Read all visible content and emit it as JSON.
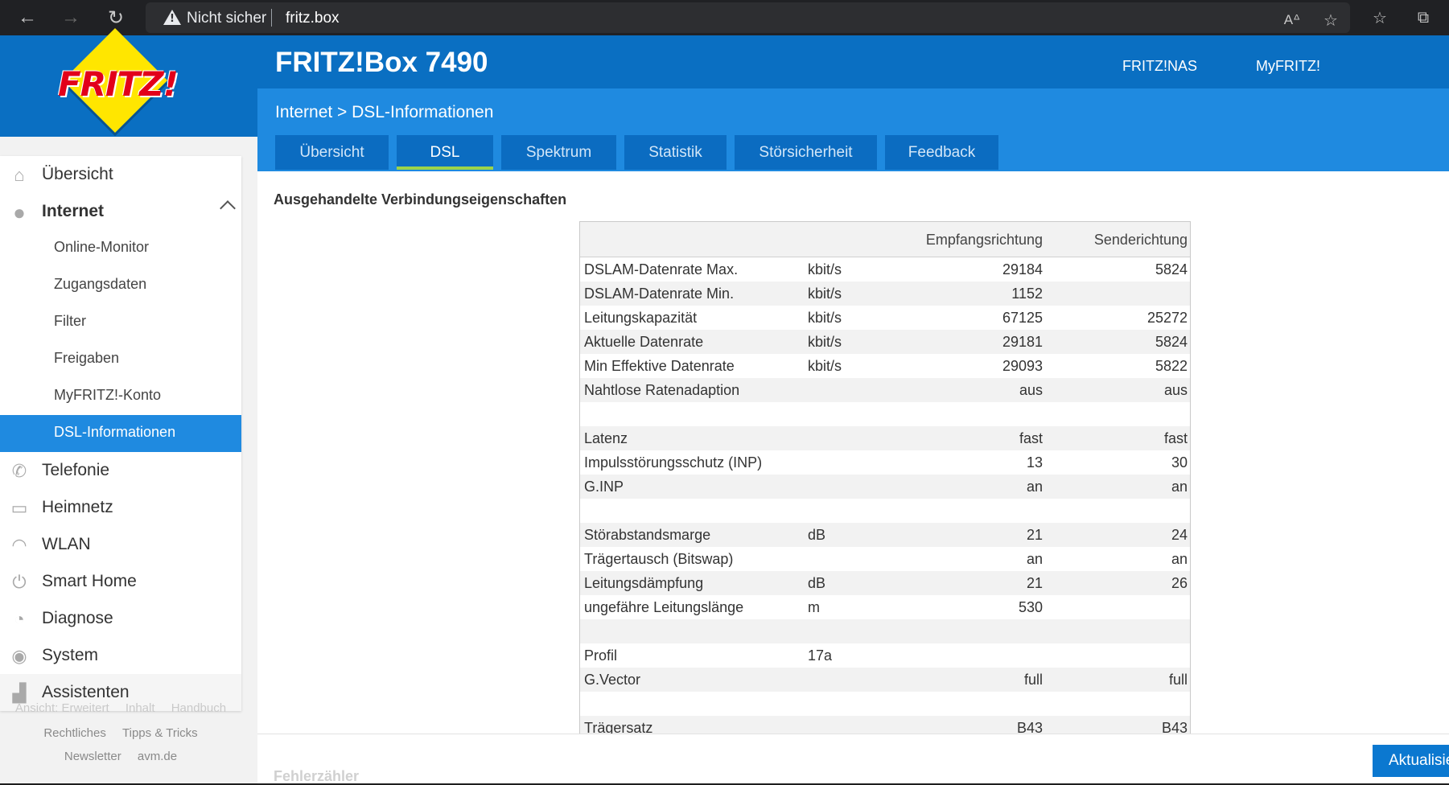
{
  "browser": {
    "security_label": "Nicht sicher",
    "url": "fritz.box"
  },
  "header": {
    "logo_text": "FRITZ!",
    "product_title": "FRITZ!Box 7490",
    "links": [
      "FRITZ!NAS",
      "MyFRITZ!"
    ],
    "accent_color": "#0a6fc2"
  },
  "breadcrumb": "Internet > DSL-Informationen",
  "tabs": [
    {
      "label": "Übersicht"
    },
    {
      "label": "DSL"
    },
    {
      "label": "Spektrum"
    },
    {
      "label": "Statistik"
    },
    {
      "label": "Störsicherheit"
    },
    {
      "label": "Feedback"
    }
  ],
  "active_tab": "DSL",
  "sidebar": {
    "items": [
      {
        "label": "Übersicht",
        "icon": "home-icon"
      },
      {
        "label": "Internet",
        "icon": "globe-icon"
      },
      {
        "label": "Telefonie",
        "icon": "phone-icon"
      },
      {
        "label": "Heimnetz",
        "icon": "network-icon"
      },
      {
        "label": "WLAN",
        "icon": "wifi-icon"
      },
      {
        "label": "Smart Home",
        "icon": "power-icon"
      },
      {
        "label": "Diagnose",
        "icon": "diagnose-icon"
      },
      {
        "label": "System",
        "icon": "system-icon"
      },
      {
        "label": "Assistenten",
        "icon": "wizard-icon"
      }
    ],
    "internet_subitems": [
      "Online-Monitor",
      "Zugangsdaten",
      "Filter",
      "Freigaben",
      "MyFRITZ!-Konto",
      "DSL-Informationen"
    ],
    "footer": {
      "ghost_links": [
        "Ansicht: Erweitert",
        "Inhalt",
        "Handbuch"
      ],
      "row1": [
        "Rechtliches",
        "Tipps & Tricks"
      ],
      "row2": [
        "Newsletter",
        "avm.de"
      ]
    }
  },
  "section_title": "Ausgehandelte Verbindungseigenschaften",
  "table": {
    "headers": [
      "",
      "",
      "Empfangsrichtung",
      "Senderichtung"
    ],
    "rows": [
      [
        "DSLAM-Datenrate Max.",
        "kbit/s",
        "29184",
        "5824"
      ],
      [
        "DSLAM-Datenrate Min.",
        "kbit/s",
        "1152",
        ""
      ],
      [
        "Leitungskapazität",
        "kbit/s",
        "67125",
        "25272"
      ],
      [
        "Aktuelle Datenrate",
        "kbit/s",
        "29181",
        "5824"
      ],
      [
        "Min Effektive Datenrate",
        "kbit/s",
        "29093",
        "5822"
      ],
      [
        "Nahtlose Ratenadaption",
        "",
        "aus",
        "aus"
      ],
      [
        "",
        "",
        "",
        ""
      ],
      [
        "Latenz",
        "",
        "fast",
        "fast"
      ],
      [
        "Impulsstörungsschutz (INP)",
        "",
        "13",
        "30"
      ],
      [
        "G.INP",
        "",
        "an",
        "an"
      ],
      [
        "",
        "",
        "",
        ""
      ],
      [
        "Störabstandsmarge",
        "dB",
        "21",
        "24"
      ],
      [
        "Trägertausch (Bitswap)",
        "",
        "an",
        "an"
      ],
      [
        "Leitungsdämpfung",
        "dB",
        "21",
        "26"
      ],
      [
        "ungefähre Leitungslänge",
        "m",
        "530",
        ""
      ],
      [
        "",
        "",
        "",
        ""
      ],
      [
        "Profil",
        "17a",
        "",
        ""
      ],
      [
        "G.Vector",
        "",
        "full",
        "full"
      ],
      [
        "",
        "",
        "",
        ""
      ],
      [
        "Trägersatz",
        "",
        "B43",
        "B43"
      ]
    ]
  },
  "next_section_title": "Fehlerzähler",
  "refresh_button": "Aktualisieren"
}
